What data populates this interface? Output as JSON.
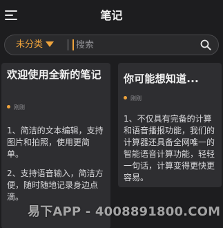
{
  "header": {
    "title": "笔记"
  },
  "search": {
    "category": "未分类",
    "placeholder": "搜索"
  },
  "notes": [
    {
      "title": "欢迎使用全新的笔记",
      "date": "刚刚",
      "body": [
        "1、简洁的文本编辑，支持图片和拍照，使用更简单。",
        "2、支持语音输入，简洁方便，随时随地记录身边点滴。"
      ]
    },
    {
      "title": "你可能想知道...",
      "date": "刚刚",
      "body": [
        "1、不仅具有完备的计算和语音播报功能，我们的计算器还具备全网唯一的智能语音计算功能，轻轻一句话，计算变得更快更容易。"
      ]
    }
  ],
  "watermark": "易下APP - 4008891800.COM",
  "colors": {
    "background": "#1d1d1f",
    "card": "#2e2e31",
    "accent": "#f0a43c"
  }
}
